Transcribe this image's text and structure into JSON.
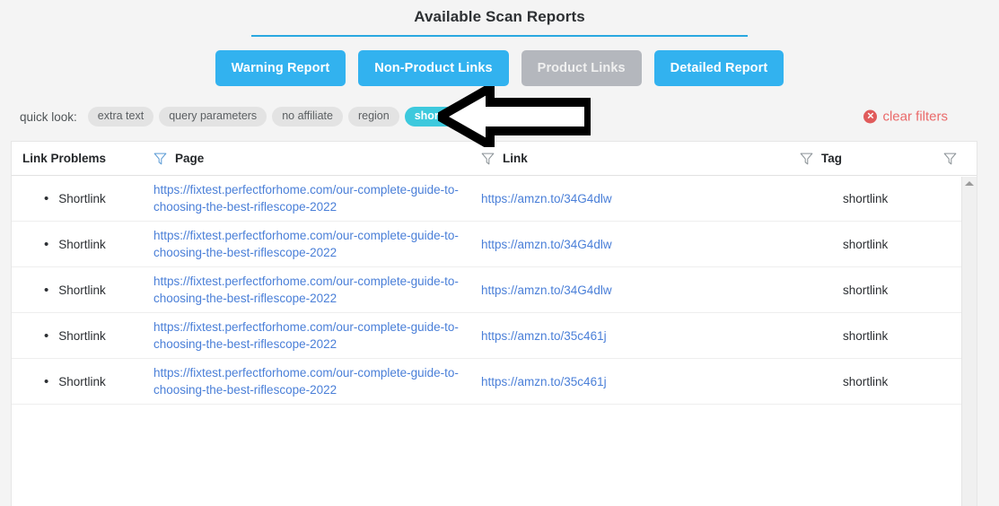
{
  "header": {
    "title": "Available Scan Reports"
  },
  "report_buttons": [
    {
      "label": "Warning Report",
      "state": "enabled",
      "color": "#32b2ef"
    },
    {
      "label": "Non-Product Links",
      "state": "enabled",
      "color": "#32b2ef"
    },
    {
      "label": "Product Links",
      "state": "selected",
      "color": "#b4b7bd"
    },
    {
      "label": "Detailed Report",
      "state": "enabled",
      "color": "#32b2ef"
    }
  ],
  "quick_look": {
    "label": "quick look:",
    "pills": [
      {
        "label": "extra text",
        "active": false
      },
      {
        "label": "query parameters",
        "active": false
      },
      {
        "label": "no affiliate",
        "active": false
      },
      {
        "label": "region",
        "active": false
      },
      {
        "label": "shortlink",
        "active": true
      }
    ],
    "active_color": "#3dc9dd",
    "inactive_color": "#e3e3e3"
  },
  "clear_filters": {
    "label": "clear filters",
    "icon": "circle-x-icon",
    "color": "#ea6a6a"
  },
  "table": {
    "columns": [
      {
        "header": "Link Problems",
        "has_filter": false
      },
      {
        "header": "Page",
        "has_filter": true
      },
      {
        "header": "Link",
        "has_filter": true
      },
      {
        "header": "Tag",
        "has_filter": true
      },
      {
        "header": "",
        "has_filter": true
      }
    ],
    "rows": [
      {
        "problem": "Shortlink",
        "page": "https://fixtest.perfectforhome.com/our-complete-guide-to-choosing-the-best-riflescope-2022",
        "link": "https://amzn.to/34G4dlw",
        "tag": "shortlink"
      },
      {
        "problem": "Shortlink",
        "page": "https://fixtest.perfectforhome.com/our-complete-guide-to-choosing-the-best-riflescope-2022",
        "link": "https://amzn.to/34G4dlw",
        "tag": "shortlink"
      },
      {
        "problem": "Shortlink",
        "page": "https://fixtest.perfectforhome.com/our-complete-guide-to-choosing-the-best-riflescope-2022",
        "link": "https://amzn.to/34G4dlw",
        "tag": "shortlink"
      },
      {
        "problem": "Shortlink",
        "page": "https://fixtest.perfectforhome.com/our-complete-guide-to-choosing-the-best-riflescope-2022",
        "link": "https://amzn.to/35c461j",
        "tag": "shortlink"
      },
      {
        "problem": "Shortlink",
        "page": "https://fixtest.perfectforhome.com/our-complete-guide-to-choosing-the-best-riflescope-2022",
        "link": "https://amzn.to/35c461j",
        "tag": "shortlink"
      }
    ],
    "bullet": "•"
  },
  "annotation": {
    "arrow": "left-pointing-arrow",
    "color": "#000000"
  }
}
